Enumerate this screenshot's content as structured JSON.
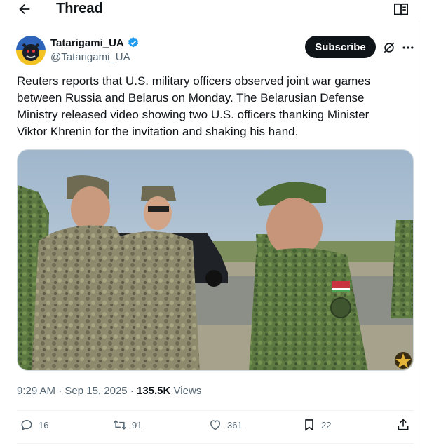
{
  "header": {
    "title": "Thread",
    "back_icon": "arrow-left-icon",
    "reader_icon": "reader-mode-icon"
  },
  "author": {
    "name": "Tatarigami_UA",
    "handle": "@Tatarigami_UA",
    "verified": true,
    "verified_color": "#1d9bf0"
  },
  "subscribe_label": "Subscribe",
  "tweet": {
    "lines": [
      "Reuters reports that U.S. military officers observed joint war games",
      "between Russia and Belarus on Monday. The Belarusian Defense",
      "Ministry released video showing two U.S. officers thanking Minister",
      "Viktor Khrenin for the invitation and shaking his hand."
    ]
  },
  "meta": {
    "time": "9:29 AM",
    "dot": "·",
    "date": "Sep 15, 2025",
    "views_count": "135.5K",
    "views_label": "Views"
  },
  "actions": {
    "replies": "16",
    "reposts": "91",
    "likes": "361",
    "bookmarks": "22"
  }
}
